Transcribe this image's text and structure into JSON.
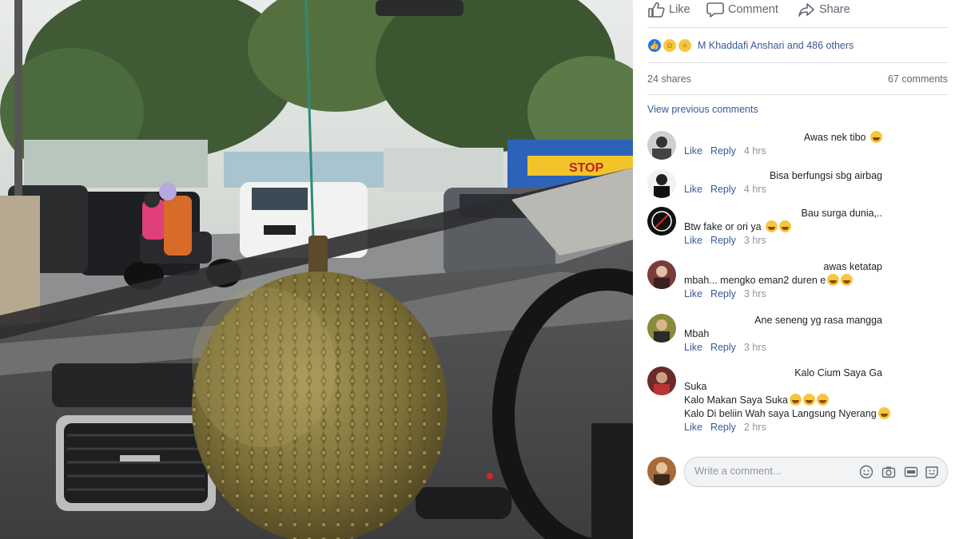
{
  "actions": {
    "like_label": "Like",
    "comment_label": "Comment",
    "share_label": "Share"
  },
  "reactions": {
    "icons": [
      "like-icon",
      "haha-icon",
      "wow-icon"
    ],
    "summary": "M Khaddafi Anshari and 486 others"
  },
  "stats": {
    "shares": "24 shares",
    "comments": "67 comments"
  },
  "view_previous": "View previous comments",
  "comments": [
    {
      "text": "Awas nek tibo",
      "emojis": 1,
      "like": "Like",
      "reply": "Reply",
      "time": "4 hrs"
    },
    {
      "text": "Bisa berfungsi sbg airbag",
      "emojis": 0,
      "like": "Like",
      "reply": "Reply",
      "time": "4 hrs"
    },
    {
      "text": "Bau surga dunia,..",
      "line2": "Btw fake or ori ya",
      "emojis_line2": 2,
      "like": "Like",
      "reply": "Reply",
      "time": "3 hrs"
    },
    {
      "text": "awas ketatap",
      "line2": "mbah... mengko eman2 duren e",
      "emojis_line2": 2,
      "like": "Like",
      "reply": "Reply",
      "time": "3 hrs"
    },
    {
      "text": "Ane seneng yg rasa mangga",
      "line2": "Mbah",
      "like": "Like",
      "reply": "Reply",
      "time": "3 hrs"
    },
    {
      "text": "Kalo Cium Saya Ga",
      "line2": "Suka",
      "line3": "Kalo Makan Saya Suka",
      "line4": "Kalo Di beliin Wah saya Langsung Nyerang",
      "like": "Like",
      "reply": "Reply",
      "time": "2 hrs"
    }
  ],
  "composer": {
    "placeholder": "Write a comment...",
    "tools": [
      "emoji-icon",
      "camera-icon",
      "gif-icon",
      "sticker-icon"
    ]
  },
  "photo": {
    "sign_text": "STOP"
  },
  "colors": {
    "link": "#385898",
    "meta": "#90949c",
    "secondary": "#606770",
    "like_blue": "#1877f2"
  }
}
